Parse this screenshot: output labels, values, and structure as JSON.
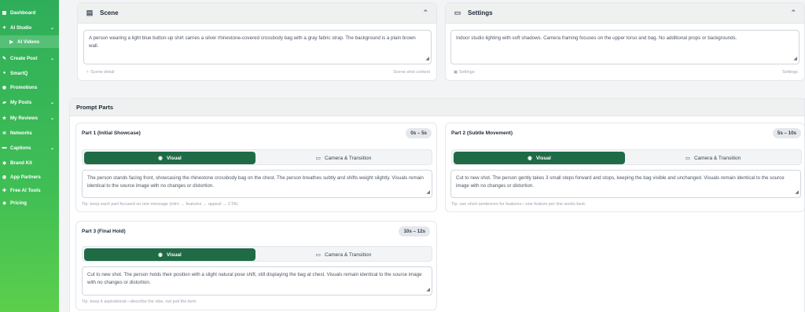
{
  "sidebar": {
    "items": [
      {
        "label": "Dashboard",
        "icon": "grid-icon"
      },
      {
        "label": "AI Studio",
        "icon": "sparkle-icon",
        "chevron": true
      },
      {
        "label": "AI Videos",
        "icon": "video-icon",
        "sub": true
      },
      {
        "label": "Create Post",
        "icon": "edit-icon",
        "chevron": true
      },
      {
        "label": "SmartQ",
        "icon": "bolt-icon"
      },
      {
        "label": "Promotions",
        "icon": "megaphone-icon"
      },
      {
        "label": "My Posts",
        "icon": "folder-icon",
        "chevron": true
      },
      {
        "label": "My Reviews",
        "icon": "star-icon",
        "chevron": true
      },
      {
        "label": "Networks",
        "icon": "wifi-icon"
      },
      {
        "label": "Captions",
        "icon": "chat-icon",
        "chevron": true
      },
      {
        "label": "Brand Kit",
        "icon": "brand-icon"
      },
      {
        "label": "App Partners",
        "icon": "people-icon"
      },
      {
        "label": "Free AI Tools",
        "icon": "tools-icon"
      },
      {
        "label": "Pricing",
        "icon": "price-icon"
      }
    ]
  },
  "scene": {
    "title": "Scene",
    "text": "A person wearing a light blue button-up shirt carries a silver rhinestone-covered crossbody bag with a gray fabric strap. The background is a plain brown wall.",
    "foot_left": "Scene detail",
    "foot_right": "Scene shot context"
  },
  "settings": {
    "title": "Settings",
    "text": "Indoor studio lighting with soft shadows. Camera framing focuses on the upper torso and bag. No additional props or backgrounds.",
    "foot_left": "Settings",
    "foot_right": "Settings"
  },
  "prompt_parts": {
    "title": "Prompt Parts",
    "tab_visual": "Visual",
    "tab_camera": "Camera & Transition",
    "parts": [
      {
        "title": "Part 1 (Initial Showcase)",
        "time": "0s – 5s",
        "text": "The person stands facing front, showcasing the rhinestone crossbody bag on the chest. The person breathes subtly and shifts weight slightly. Visuals remain identical to the source image with no changes or distortion.",
        "tip": "Tip: keep each part focused on one message (intro → features → appeal → CTA)."
      },
      {
        "title": "Part 2 (Subtle Movement)",
        "time": "5s – 10s",
        "text": "Cut to new shot. The person gently takes 3 small steps forward and stops, keeping the bag visible and unchanged. Visuals remain identical to the source image with no changes or distortion.",
        "tip": "Tip: use short sentences for features—one feature per line works best."
      },
      {
        "title": "Part 3 (Final Hold)",
        "time": "10s – 12s",
        "text": "Cut to new shot. The person holds their position with a slight natural pose shift, still displaying the bag at chest. Visuals remain identical to the source image with no changes or distortion.",
        "tip": "Tip: keep it aspirational—describe the vibe, not just the item."
      }
    ]
  },
  "colors": {
    "sidebar_green": "#3fbe55",
    "tab_active": "#1f6b46"
  }
}
